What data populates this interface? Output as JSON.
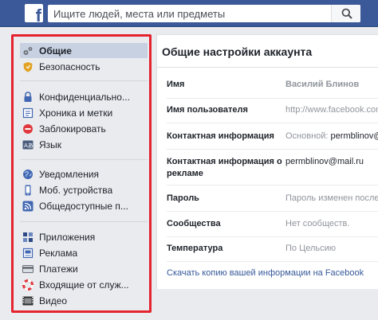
{
  "topbar": {
    "logo": "f",
    "search_placeholder": "Ищите людей, места или предметы",
    "search_icon": "search-icon",
    "color": "#3b5998"
  },
  "sidebar": {
    "groups": [
      {
        "items": [
          {
            "label": "Общие",
            "icon": "gear-icon",
            "active": true
          },
          {
            "label": "Безопасность",
            "icon": "shield-icon",
            "active": false
          }
        ]
      },
      {
        "items": [
          {
            "label": "Конфиденциально...",
            "icon": "lock-icon",
            "active": false
          },
          {
            "label": "Хроника и метки",
            "icon": "timeline-icon",
            "active": false
          },
          {
            "label": "Заблокировать",
            "icon": "block-icon",
            "active": false
          },
          {
            "label": "Язык",
            "icon": "language-icon",
            "active": false
          }
        ]
      },
      {
        "items": [
          {
            "label": "Уведомления",
            "icon": "globe-icon",
            "active": false
          },
          {
            "label": "Моб. устройства",
            "icon": "phone-icon",
            "active": false
          },
          {
            "label": "Общедоступные п...",
            "icon": "rss-icon",
            "active": false
          }
        ]
      },
      {
        "items": [
          {
            "label": "Приложения",
            "icon": "apps-icon",
            "active": false
          },
          {
            "label": "Реклама",
            "icon": "ads-icon",
            "active": false
          },
          {
            "label": "Платежи",
            "icon": "card-icon",
            "active": false
          },
          {
            "label": "Входящие от служ...",
            "icon": "lifebuoy-icon",
            "active": false
          },
          {
            "label": "Видео",
            "icon": "video-icon",
            "active": false
          }
        ]
      }
    ],
    "highlight_color": "#e5232f"
  },
  "main": {
    "title": "Общие настройки аккаунта",
    "rows": [
      {
        "label": "Имя",
        "value": "Василий Блинов",
        "value_strong": ""
      },
      {
        "label": "Имя пользователя",
        "value": "http://www.facebook.com",
        "value_strong": ""
      },
      {
        "label": "Контактная информация",
        "value": "Основной: ",
        "value_strong": "permblinov@"
      },
      {
        "label": "Контактная информация о рекламе",
        "value": "",
        "value_strong": "permblinov@mail.ru"
      },
      {
        "label": "Пароль",
        "value": "Пароль изменен послед",
        "value_strong": ""
      },
      {
        "label": "Сообщества",
        "value": "Нет сообществ.",
        "value_strong": ""
      },
      {
        "label": "Температура",
        "value": "По Цельсию",
        "value_strong": ""
      }
    ],
    "download": {
      "prefix": "Скачать копию",
      "suffix": " вашей информации на Facebook"
    }
  }
}
